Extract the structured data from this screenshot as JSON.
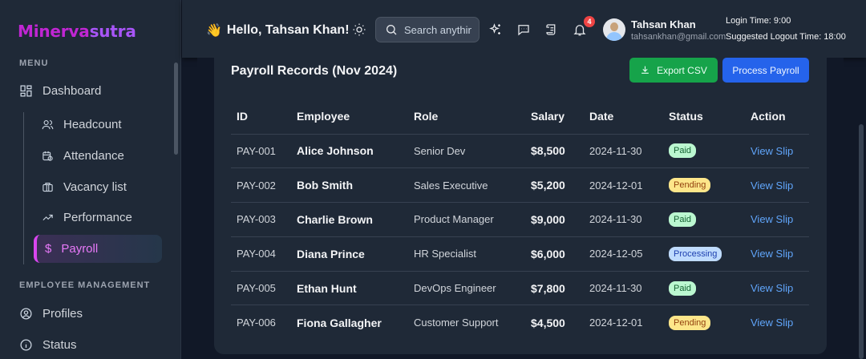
{
  "app": {
    "logo_part1": "Minerva",
    "logo_part2": "sutra"
  },
  "sidebar": {
    "menu_label": "MENU",
    "dashboard": "Dashboard",
    "headcount": "Headcount",
    "attendance": "Attendance",
    "vacancy": "Vacancy list",
    "performance": "Performance",
    "payroll": "Payroll",
    "employee_label": "EMPLOYEE MANAGEMENT",
    "profiles": "Profiles",
    "status": "Status"
  },
  "header": {
    "wave": "👋",
    "greeting": "Hello, Tahsan Khan!",
    "search_placeholder": "Search anything",
    "notification_count": "4",
    "user_name": "Tahsan Khan",
    "user_email": "tahsankhan@gmail.com",
    "login_time": "Login Time: 9:00",
    "logout_time": "Suggested Logout Time: 18:00"
  },
  "payroll": {
    "title": "Payroll Records (Nov 2024)",
    "export_label": "Export CSV",
    "process_label": "Process Payroll",
    "columns": [
      "ID",
      "Employee",
      "Role",
      "Salary",
      "Date",
      "Status",
      "Action"
    ],
    "rows": [
      {
        "id": "PAY-001",
        "employee": "Alice Johnson",
        "role": "Senior Dev",
        "salary": "$8,500",
        "date": "2024-11-30",
        "status": "Paid",
        "action": "View Slip"
      },
      {
        "id": "PAY-002",
        "employee": "Bob Smith",
        "role": "Sales Executive",
        "salary": "$5,200",
        "date": "2024-12-01",
        "status": "Pending",
        "action": "View Slip"
      },
      {
        "id": "PAY-003",
        "employee": "Charlie Brown",
        "role": "Product Manager",
        "salary": "$9,000",
        "date": "2024-11-30",
        "status": "Paid",
        "action": "View Slip"
      },
      {
        "id": "PAY-004",
        "employee": "Diana Prince",
        "role": "HR Specialist",
        "salary": "$6,000",
        "date": "2024-12-05",
        "status": "Processing",
        "action": "View Slip"
      },
      {
        "id": "PAY-005",
        "employee": "Ethan Hunt",
        "role": "DevOps Engineer",
        "salary": "$7,800",
        "date": "2024-11-30",
        "status": "Paid",
        "action": "View Slip"
      },
      {
        "id": "PAY-006",
        "employee": "Fiona Gallagher",
        "role": "Customer Support",
        "salary": "$4,500",
        "date": "2024-12-01",
        "status": "Pending",
        "action": "View Slip"
      }
    ]
  },
  "colors": {
    "accent": "#d946ef",
    "export_button": "#16a34a",
    "process_button": "#2563eb",
    "paid": "#bbf7d0",
    "pending": "#fde68a",
    "processing": "#bfdbfe"
  },
  "icons": {
    "dashboard": "grid-icon",
    "headcount": "users-icon",
    "attendance": "calendar-clock-icon",
    "vacancy": "briefcase-icon",
    "performance": "trending-up-icon",
    "payroll": "dollar-icon",
    "profiles": "user-circle-icon",
    "status": "info-icon",
    "theme": "sun-icon",
    "search": "search-icon",
    "ai": "sparkles-icon",
    "chat": "message-icon",
    "docs": "scroll-icon",
    "notifications": "bell-icon",
    "export": "download-icon"
  }
}
